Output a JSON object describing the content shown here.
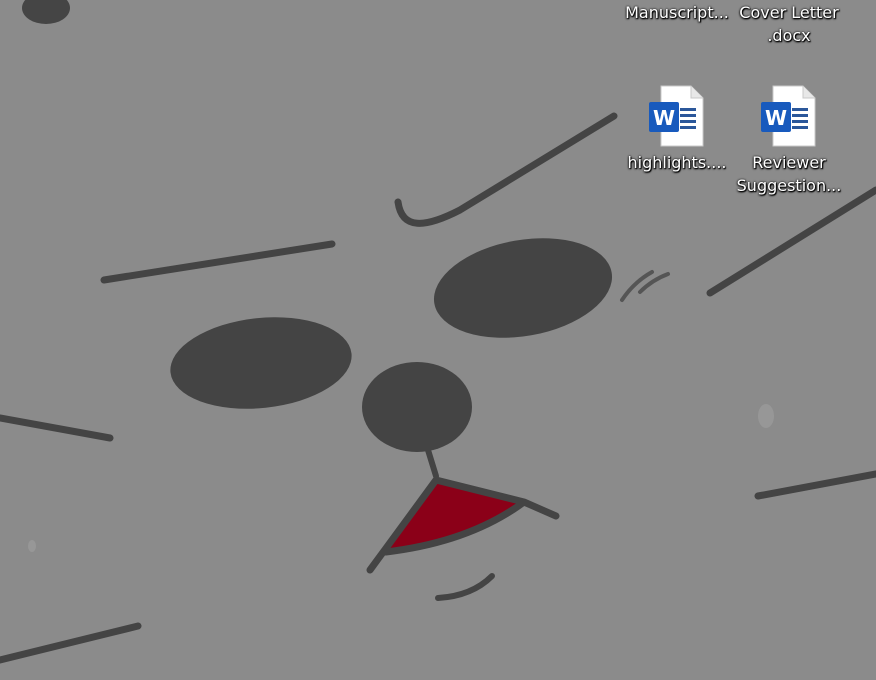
{
  "desktop": {
    "icons": [
      {
        "name": "manuscript-file-icon",
        "label_lines": [
          "Manuscript..."
        ]
      },
      {
        "name": "cover-letter-file-icon",
        "label_lines": [
          "Cover Letter",
          ".docx"
        ]
      },
      {
        "name": "highlights-file-icon",
        "label_lines": [
          "highlights...."
        ],
        "type": "word-document"
      },
      {
        "name": "reviewer-suggestions-file-icon",
        "label_lines": [
          "Reviewer",
          "Suggestion..."
        ],
        "type": "word-document"
      }
    ]
  },
  "colors": {
    "wallpaper_bg": "#8a8a8a",
    "wallpaper_line": "#3f3f3f",
    "tongue": "#8b0018",
    "word_blue": "#185abd"
  }
}
